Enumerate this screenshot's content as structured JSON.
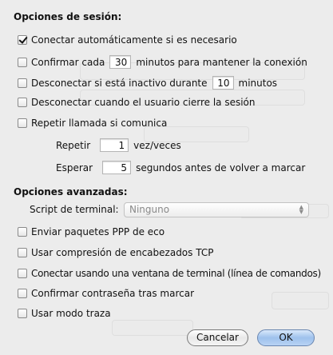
{
  "session": {
    "title": "Opciones de sesión:",
    "connect_auto": "Conectar automáticamente si es necesario",
    "confirm_every_prefix": "Confirmar cada",
    "confirm_every_value": "30",
    "confirm_every_suffix": "minutos para mantener la conexión",
    "disconnect_idle_prefix": "Desconectar si está inactivo durante",
    "disconnect_idle_value": "10",
    "disconnect_idle_suffix": "minutos",
    "disconnect_logout": "Desconectar cuando el usuario cierre la sesión",
    "redial": "Repetir llamada si comunica",
    "repeat_label": "Repetir",
    "repeat_value": "1",
    "repeat_suffix": "vez/veces",
    "wait_label": "Esperar",
    "wait_value": "5",
    "wait_suffix": "segundos antes de volver a marcar"
  },
  "advanced": {
    "title": "Opciones avanzadas:",
    "terminal_label": "Script de terminal:",
    "terminal_value": "Ninguno",
    "ppp_echo": "Enviar paquetes PPP de eco",
    "tcp_compression": "Usar compresión de encabezados TCP",
    "terminal_window": "Conectar usando una ventana de terminal (línea de comandos)",
    "confirm_password": "Confirmar contraseña tras marcar",
    "trace_mode": "Usar modo traza"
  },
  "buttons": {
    "cancel": "Cancelar",
    "ok": "OK"
  },
  "state": {
    "connect_auto_checked": true
  }
}
